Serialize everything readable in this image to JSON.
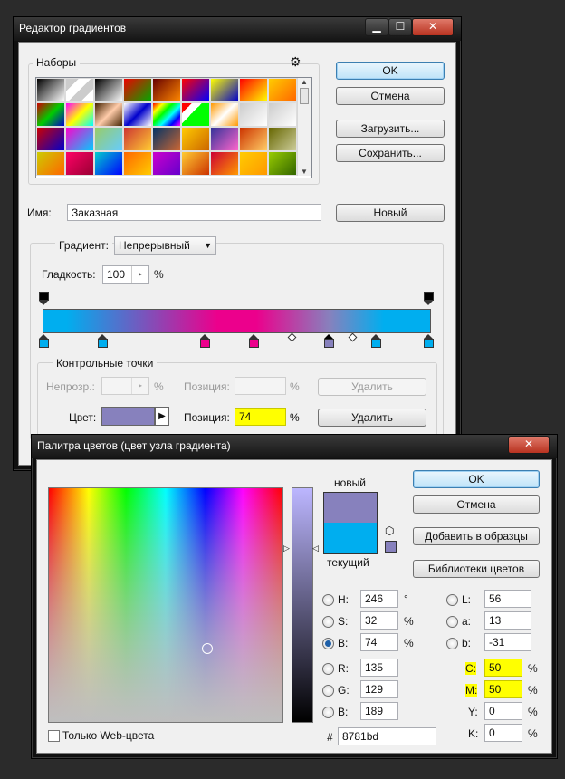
{
  "gradient_editor": {
    "title": "Редактор градиентов",
    "presets_label": "Наборы",
    "presets_menu_icon": "gear-icon",
    "ok": "OK",
    "cancel": "Отмена",
    "load": "Загрузить...",
    "save": "Сохранить...",
    "name_label": "Имя:",
    "name_value": "Заказная",
    "new_button": "Новый",
    "gradient_type_label": "Градиент:",
    "gradient_type_value": "Непрерывный",
    "smoothness_label": "Гладкость:",
    "smoothness_value": "100",
    "percent": "%",
    "stops_group": "Контрольные точки",
    "opacity_label": "Непрозр.:",
    "position_label": "Позиция:",
    "delete": "Удалить",
    "color_label": "Цвет:",
    "position_value": "74",
    "gradient_colors": [
      "#00aeef",
      "#ec008c",
      "#8781bd",
      "#00aeef"
    ]
  },
  "color_picker": {
    "title": "Палитра цветов (цвет узла градиента)",
    "ok": "OK",
    "cancel": "Отмена",
    "add_swatch": "Добавить в образцы",
    "libraries": "Библиотеки цветов",
    "new_label": "новый",
    "current_label": "текущий",
    "new_color": "#8781bd",
    "current_color": "#00aeef",
    "fields": {
      "H": {
        "label": "H:",
        "value": "246",
        "unit": "°"
      },
      "S": {
        "label": "S:",
        "value": "32",
        "unit": "%"
      },
      "B": {
        "label": "B:",
        "value": "74",
        "unit": "%"
      },
      "R": {
        "label": "R:",
        "value": "135"
      },
      "G": {
        "label": "G:",
        "value": "129"
      },
      "Bl": {
        "label": "B:",
        "value": "189"
      },
      "L": {
        "label": "L:",
        "value": "56"
      },
      "a": {
        "label": "a:",
        "value": "13"
      },
      "b": {
        "label": "b:",
        "value": "-31"
      },
      "C": {
        "label": "C:",
        "value": "50",
        "unit": "%"
      },
      "M": {
        "label": "M:",
        "value": "50",
        "unit": "%"
      },
      "Y": {
        "label": "Y:",
        "value": "0",
        "unit": "%"
      },
      "K": {
        "label": "K:",
        "value": "0",
        "unit": "%"
      }
    },
    "hex_label": "#",
    "hex_value": "8781bd",
    "web_only_label": "Только Web-цвета"
  }
}
